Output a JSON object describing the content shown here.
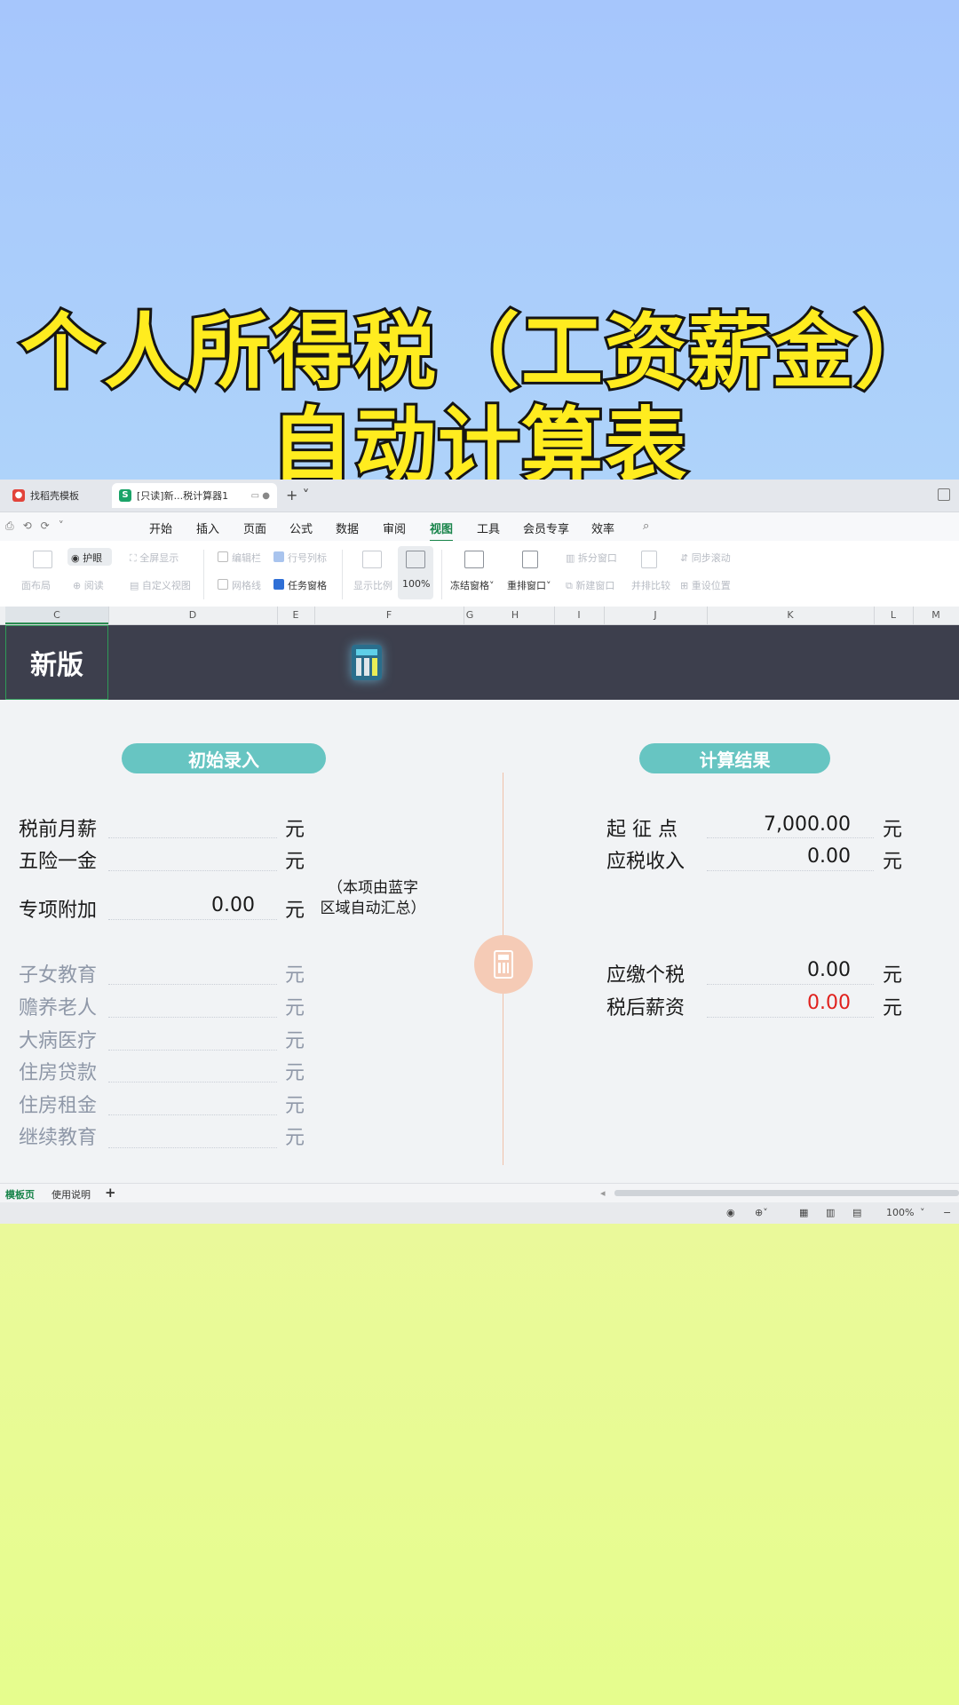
{
  "headline": {
    "line1": "个人所得税（工资薪金）",
    "line2": "自动计算表"
  },
  "tabs": [
    {
      "label": "找稻壳模板",
      "icon": "wps-daoke-icon"
    },
    {
      "label": "[只读]新...税计算器1",
      "icon": "wps-sheet-icon"
    }
  ],
  "menu": [
    "开始",
    "插入",
    "页面",
    "公式",
    "数据",
    "审阅",
    "视图",
    "工具",
    "会员专享",
    "效率"
  ],
  "menu_active": "视图",
  "ribbon": {
    "eye_protect": "护眼",
    "fullscreen": "全屏显示",
    "page_layout": "面布局",
    "read": "阅读",
    "custom_view": "自定义视图",
    "edit_bar": "编辑栏",
    "row_col_header": "行号列标",
    "gridlines": "网格线",
    "task_pane": "任务窗格",
    "zoom_ratio": "显示比例",
    "zoom_100": "100%",
    "freeze": "冻结窗格",
    "rearrange": "重排窗口",
    "split": "拆分窗口",
    "new_window": "新建窗口",
    "side_by_side": "并排比较",
    "sync_scroll": "同步滚动",
    "reset_pos": "重设位置"
  },
  "columns": [
    "C",
    "D",
    "E",
    "F",
    "G",
    "H",
    "I",
    "J",
    "K",
    "L",
    "M"
  ],
  "banner_text": "新版",
  "left": {
    "title": "初始录入",
    "rows": [
      {
        "label": "税前月薪",
        "value": "",
        "unit": "元"
      },
      {
        "label": "五险一金",
        "value": "",
        "unit": "元"
      },
      {
        "label": "专项附加",
        "value": "0.00",
        "unit": "元"
      }
    ],
    "note": "（本项由蓝字区域自动汇总）",
    "note_line1": "（本项由蓝字",
    "note_line2": "区域自动汇总）",
    "deductions": [
      {
        "label": "子女教育",
        "unit": "元"
      },
      {
        "label": "赡养老人",
        "unit": "元"
      },
      {
        "label": "大病医疗",
        "unit": "元"
      },
      {
        "label": "住房贷款",
        "unit": "元"
      },
      {
        "label": "住房租金",
        "unit": "元"
      },
      {
        "label": "继续教育",
        "unit": "元"
      }
    ]
  },
  "right": {
    "title": "计算结果",
    "rows": [
      {
        "label": "起 征 点",
        "value": "7,000.00",
        "unit": "元"
      },
      {
        "label": "应税收入",
        "value": "0.00",
        "unit": "元"
      },
      {
        "label": "应缴个税",
        "value": "0.00",
        "unit": "元"
      },
      {
        "label": "税后薪资",
        "value": "0.00",
        "unit": "元"
      }
    ]
  },
  "sheets": [
    "模板页",
    "使用说明"
  ],
  "status": {
    "zoom": "100%"
  },
  "colors": {
    "accent": "#18844a",
    "pill": "#67c5c2",
    "banner": "#3d3f4d",
    "result_red": "#e0211d"
  }
}
